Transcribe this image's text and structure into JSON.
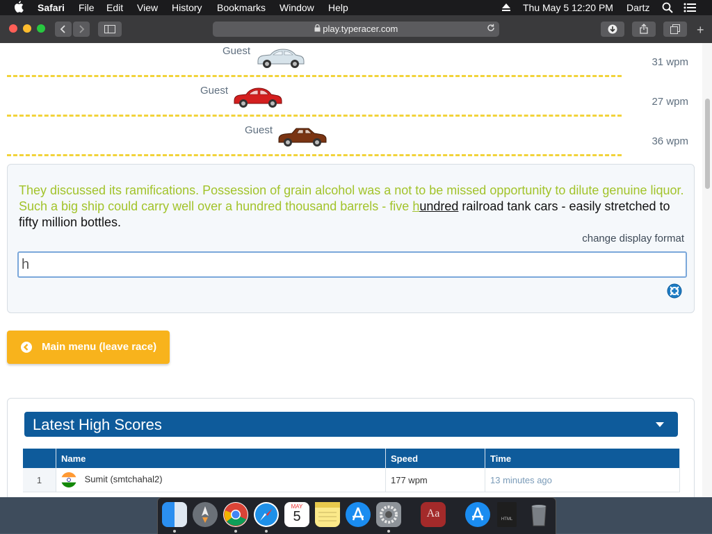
{
  "menubar": {
    "app_name": "Safari",
    "items": [
      "File",
      "Edit",
      "View",
      "History",
      "Bookmarks",
      "Window",
      "Help"
    ],
    "clock": "Thu May 5  12:20 PM",
    "user": "Dartz"
  },
  "browser": {
    "url": "play.typeracer.com"
  },
  "race": {
    "players": [
      {
        "name": "Guest",
        "speed": "31 wpm",
        "car_color": "#d7e3ea"
      },
      {
        "name": "Guest",
        "speed": "27 wpm",
        "car_color": "#d41f1f"
      },
      {
        "name": "Guest",
        "speed": "36 wpm",
        "car_color": "#7a3412"
      }
    ],
    "text_typed": "They discussed its ramifications. Possession of grain alcohol was a not to be missed opportunity to dilute genuine liquor. Such a big ship could carry well over a hundred thousand barrels - five ",
    "text_current_typed": "h",
    "text_current_rest": "undred",
    "text_remaining": " railroad tank cars - easily stretched to fifty million bottles.",
    "change_display_format": "change display format",
    "input_value": "h"
  },
  "main_menu_button": "Main menu (leave race)",
  "high_scores": {
    "title": "Latest High Scores",
    "columns": [
      "Name",
      "Speed",
      "Time"
    ],
    "rows": [
      {
        "rank": "1",
        "name": "Sumit (smtchahal2)",
        "speed": "177 wpm",
        "time": "13 minutes ago"
      }
    ]
  },
  "dock": {
    "apps": [
      "finder-icon",
      "launchpad-icon",
      "chrome-icon",
      "safari-icon",
      "calendar-icon",
      "notes-icon",
      "app-store-icon",
      "system-preferences-icon",
      "dictionary-icon",
      "app-store-download-icon",
      "html-file-icon",
      "trash-icon"
    ],
    "calendar_month": "MAY",
    "calendar_day": "5",
    "dictionary_label": "Aa",
    "html_file_label": "HTML"
  }
}
